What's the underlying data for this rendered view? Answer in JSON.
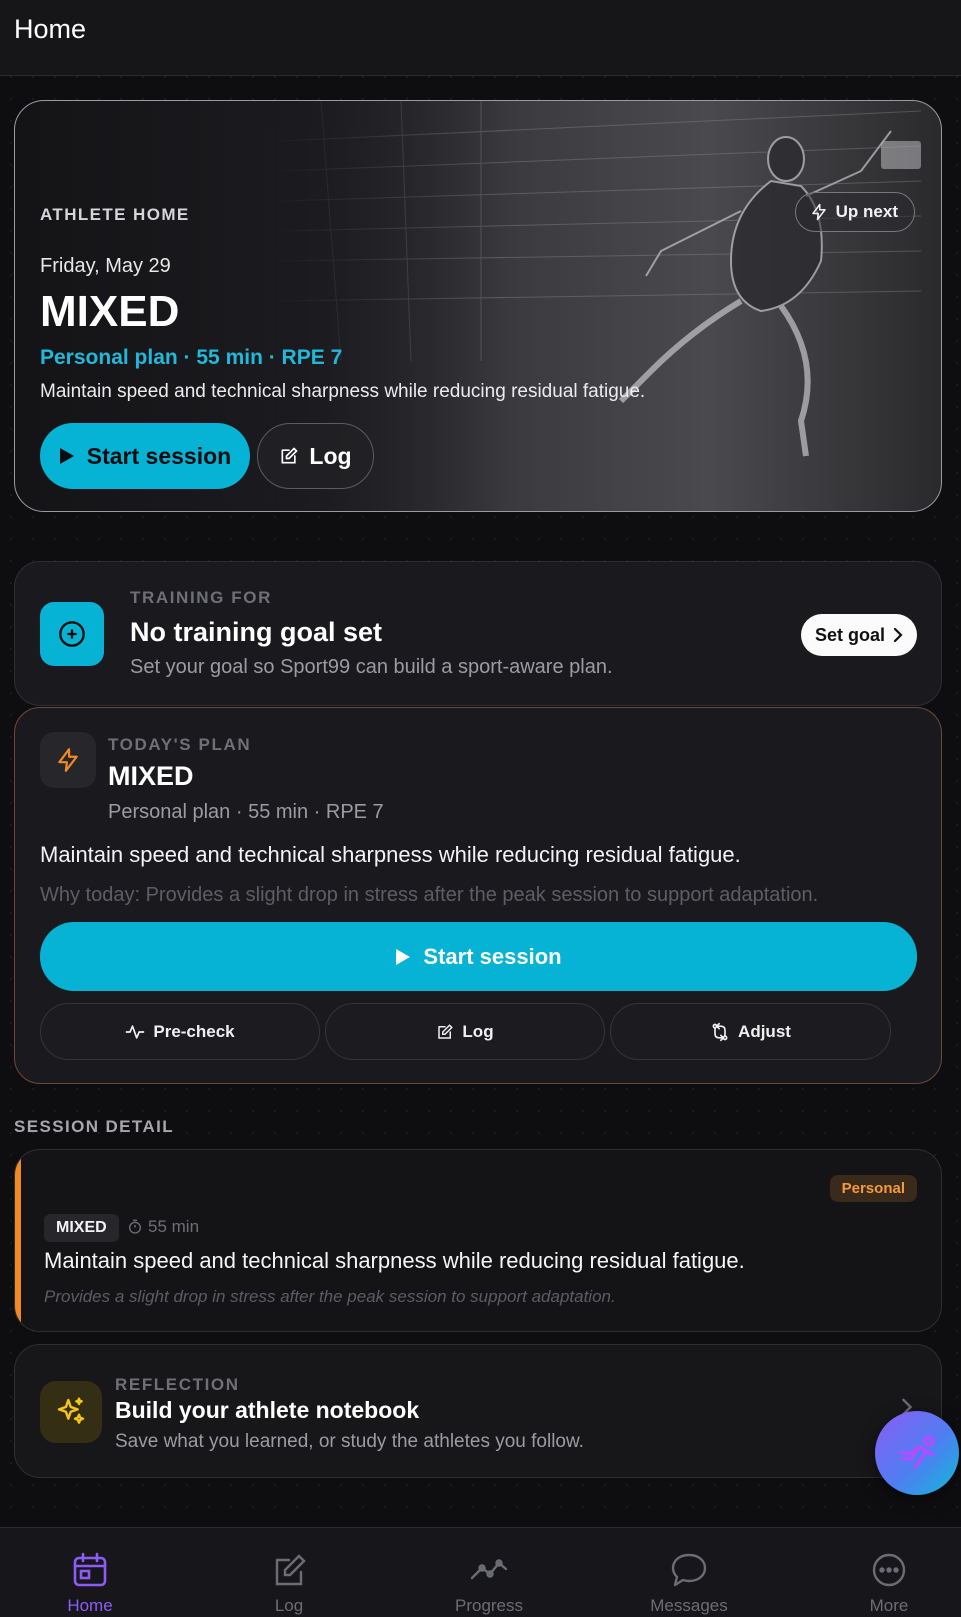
{
  "header": {
    "title": "Home"
  },
  "hero": {
    "eyebrow": "ATHLETE HOME",
    "up_next": "Up next",
    "date": "Friday, May 29",
    "session_type": "MIXED",
    "meta": "Personal plan · 55 min · RPE 7",
    "description": "Maintain speed and technical sharpness while reducing residual fatigue.",
    "start_label": "Start session",
    "log_label": "Log"
  },
  "goal": {
    "eyebrow": "TRAINING FOR",
    "title": "No training goal set",
    "subtitle": "Set your goal so Sport99 can build a sport-aware plan.",
    "button": "Set goal"
  },
  "plan": {
    "eyebrow": "TODAY'S PLAN",
    "title": "MIXED",
    "meta": "Personal plan · 55 min · RPE 7",
    "description": "Maintain speed and technical sharpness while reducing residual fatigue.",
    "why": "Why today: Provides a slight drop in stress after the peak session to support adaptation.",
    "start_label": "Start session",
    "actions": {
      "precheck": "Pre-check",
      "log": "Log",
      "adjust": "Adjust"
    }
  },
  "session_detail": {
    "label": "SESSION DETAIL",
    "badge": "Personal",
    "tag": "MIXED",
    "duration": "55 min",
    "description": "Maintain speed and technical sharpness while reducing residual fatigue.",
    "note": "Provides a slight drop in stress after the peak session to support adaptation."
  },
  "reflection": {
    "eyebrow": "REFLECTION",
    "title": "Build your athlete notebook",
    "subtitle": "Save what you learned, or study the athletes you follow."
  },
  "tabs": [
    {
      "label": "Home",
      "icon": "calendar-icon",
      "active": true
    },
    {
      "label": "Log",
      "icon": "edit-icon",
      "active": false
    },
    {
      "label": "Progress",
      "icon": "trend-icon",
      "active": false
    },
    {
      "label": "Messages",
      "icon": "chat-icon",
      "active": false
    },
    {
      "label": "More",
      "icon": "more-icon",
      "active": false
    }
  ],
  "colors": {
    "accent": "#06b3d4",
    "active_tab": "#8b5cf6",
    "plan_border": "#6b4a34",
    "personal": "#f08a26"
  }
}
